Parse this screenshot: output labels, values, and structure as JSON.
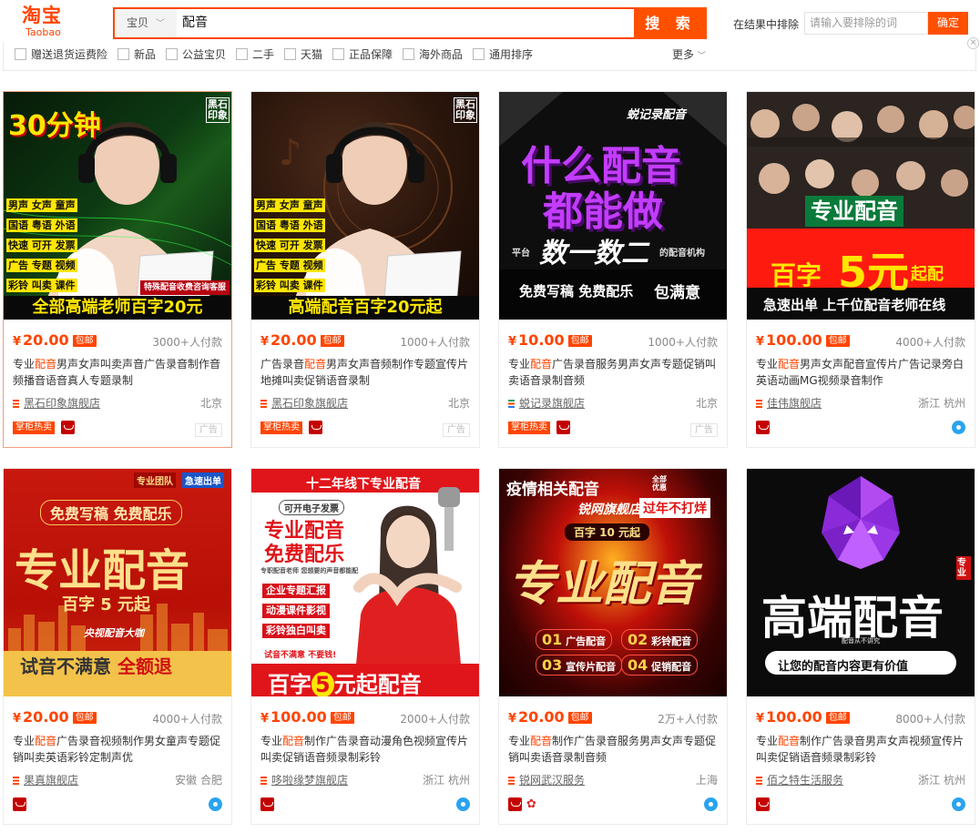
{
  "header": {
    "logo_cn": "淘宝",
    "logo_en": "Taobao",
    "category": "宝贝",
    "query": "配音",
    "search_label": "搜 索",
    "exclude_label": "在结果中排除",
    "exclude_placeholder": "请输入要排除的词",
    "exclude_confirm": "确定"
  },
  "filters": {
    "items": [
      "赠送退货运费险",
      "新品",
      "公益宝贝",
      "二手",
      "天猫",
      "正品保障",
      "海外商品",
      "通用排序"
    ],
    "more": "更多"
  },
  "colors": {
    "brand": "#ff4400",
    "accent": "#ff5000"
  },
  "products": [
    {
      "price": "20.00",
      "baoyou": "包邮",
      "deals": "3000+人付款",
      "title_pre": "专业",
      "title_kw": "配音",
      "title_post": "男声女声叫卖声音广告录音制作音频播音语音真人专题录制",
      "shop": "黑石印象旗舰店",
      "location": "北京",
      "hot": "掌柜热卖",
      "ad": "广告",
      "img": {
        "badge": "30分钟",
        "brand": "黑石印象",
        "tags": [
          "男声 女声 童声",
          "国语 粤语 外语",
          "快速 可开 发票",
          "广告 专题 视频",
          "彩铃 叫卖 课件"
        ],
        "note": "特殊配音收费咨询客服",
        "banner": "全部高端老师百字20元"
      }
    },
    {
      "price": "20.00",
      "baoyou": "包邮",
      "deals": "1000+人付款",
      "title_pre": "广告录音",
      "title_kw": "配音",
      "title_post": "男声女声音频制作专题宣传片地摊叫卖促销语音录制",
      "shop": "黑石印象旗舰店",
      "location": "北京",
      "hot": "掌柜热卖",
      "ad": "广告",
      "img": {
        "brand": "黑石印象",
        "tags": [
          "男声 女声 童声",
          "国语 粤语 外语",
          "快速 可开 发票",
          "广告 专题 视频",
          "彩铃 叫卖 课件"
        ],
        "banner": "高端配音百字20元起"
      }
    },
    {
      "price": "10.00",
      "baoyou": "包邮",
      "deals": "1000+人付款",
      "title_pre": "专业",
      "title_kw": "配音",
      "title_post": "广告录音服务男声女声专题促销叫卖语音录制音频",
      "shop": "蜕记录旗舰店",
      "location": "北京",
      "hot": "掌柜热卖",
      "ad": "广告",
      "img": {
        "brand": "蜕记录配音",
        "line1": "什么配音",
        "line2": "都能做",
        "sub_pre": "平台",
        "sub_big": "数一数二",
        "sub_post": "的配音机构",
        "bottom": "免费写稿  免费配乐",
        "ok": "包满意"
      }
    },
    {
      "price": "100.00",
      "baoyou": "包邮",
      "deals": "4000+人付款",
      "title_pre": "专业",
      "title_kw": "配音",
      "title_post": "男声女声配音宣传片广告记录旁白英语动画MG视频录音制作",
      "shop": "佳伟旗舰店",
      "location": "浙江 杭州",
      "img": {
        "tag": "专业配音",
        "price_pre": "百字",
        "price_big": "5元",
        "price_post": "起配",
        "bottom": "急速出单 上千位配音老师在线"
      }
    },
    {
      "price": "20.00",
      "baoyou": "包邮",
      "deals": "4000+人付款",
      "title_pre": "专业",
      "title_kw": "配音",
      "title_post": "广告录音视频制作男女童声专题促销叫卖英语彩铃定制声优",
      "shop": "果真旗舰店",
      "location": "安徽 合肥",
      "img": {
        "corner1": "专业团队",
        "corner2": "急速出单",
        "free": "免费写稿  免费配乐",
        "main": "专业配音",
        "price": "百字 5 元起",
        "sign": "央视配音大咖",
        "bottom_pre": "试音不满意",
        "bottom_hl": "全额退"
      }
    },
    {
      "price": "100.00",
      "baoyou": "包邮",
      "deals": "2000+人付款",
      "title_pre": "专业",
      "title_kw": "配音",
      "title_post": "制作广告录音动漫角色视频宣传片叫卖促销语音频录制彩铃",
      "shop": "哆啦缘梦旗舰店",
      "location": "浙江 杭州",
      "img": {
        "top": "十二年线下专业配音",
        "invoice": "可开电子发票",
        "main1": "专业配音",
        "main2": "免费配乐",
        "small": "专职配音老师 您想要的声音都能配",
        "list": [
          "企业专题汇报",
          "动漫课件影视",
          "彩铃独白叫卖"
        ],
        "warn": "试音不满意 不要钱!",
        "bottom_pre": "百字",
        "bottom_num": "5",
        "bottom_post": "元起配音"
      }
    },
    {
      "price": "20.00",
      "baoyou": "包邮",
      "deals": "2万+人付款",
      "title_pre": "专业",
      "title_kw": "配音",
      "title_post": "制作广告录音服务男声女声专题促销叫卖语音录制音频",
      "shop": "锐网武汉服务",
      "location": "上海",
      "img": {
        "top": "疫情相关配音",
        "top_side": "全部优惠",
        "shop": "锐网旗舰店",
        "holiday": "过年不打烊",
        "price": "百字 10 元起",
        "main": "专业配音",
        "items": [
          {
            "n": "01",
            "t": "广告配音"
          },
          {
            "n": "02",
            "t": "彩铃配音"
          },
          {
            "n": "03",
            "t": "宣传片配音"
          },
          {
            "n": "04",
            "t": "促销配音"
          }
        ]
      }
    },
    {
      "price": "100.00",
      "baoyou": "包邮",
      "deals": "8000+人付款",
      "title_pre": "专业",
      "title_kw": "配音",
      "title_post": "制作广告录音男声女声视频宣传片叫卖促销语音频录制彩铃",
      "shop": "佰之特生活服务",
      "location": "浙江 杭州",
      "img": {
        "side": "专业",
        "main": "高端配音",
        "small": "配音从不讲究",
        "bottom": "让您的配音内容更有价值"
      }
    }
  ]
}
